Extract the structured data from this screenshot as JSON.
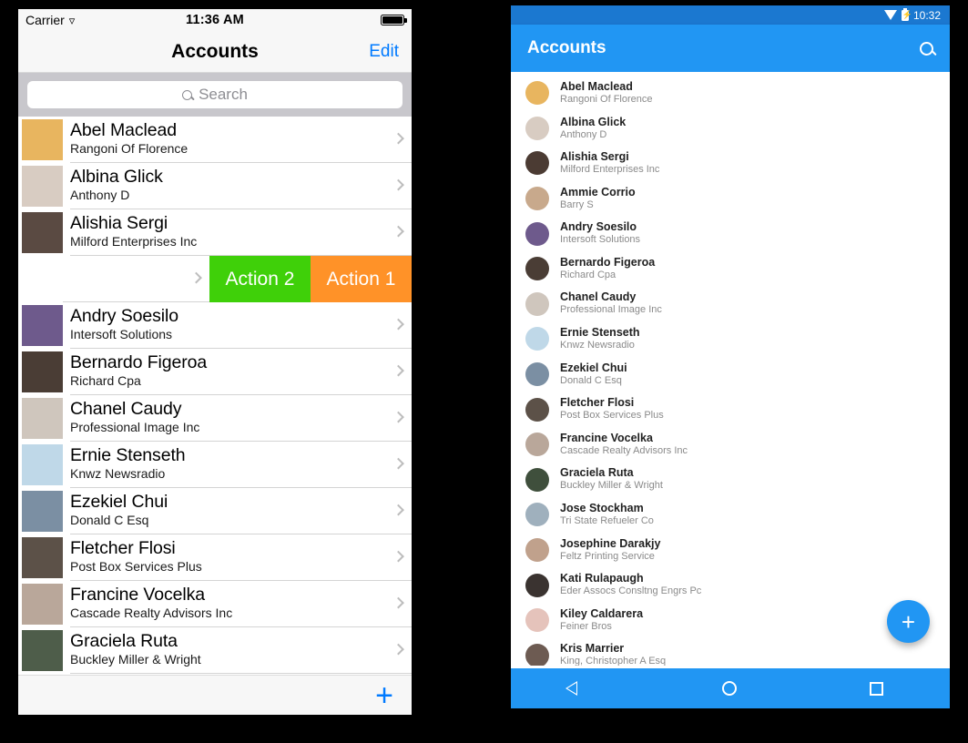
{
  "ios": {
    "status_bar": {
      "carrier": "Carrier",
      "wifi_icon": "wifi-icon",
      "time": "11:36 AM",
      "battery_icon": "battery-full-icon"
    },
    "nav": {
      "title": "Accounts",
      "edit_label": "Edit"
    },
    "search": {
      "icon": "search-icon",
      "placeholder": "Search",
      "value": ""
    },
    "toolbar": {
      "add_label": "+"
    },
    "swipe_actions": [
      {
        "label": "Action 2",
        "color": "#3fd009"
      },
      {
        "label": "Action 1",
        "color": "#ff9228"
      }
    ],
    "swiped_row_index": 3,
    "rows": [
      {
        "name": "Abel Maclead",
        "subtitle": "Rangoni Of Florence",
        "avatar": "#e8b55f"
      },
      {
        "name": "Albina Glick",
        "subtitle": "Anthony D",
        "avatar": "#d8ccc2"
      },
      {
        "name": "Alishia Sergi",
        "subtitle": "Milford Enterprises Inc",
        "avatar": "#5a4a42"
      },
      {
        "name": "",
        "subtitle": "",
        "avatar": "#8c7f70"
      },
      {
        "name": "Andry Soesilo",
        "subtitle": "Intersoft Solutions",
        "avatar": "#6e5a8c"
      },
      {
        "name": "Bernardo Figeroa",
        "subtitle": "Richard Cpa",
        "avatar": "#4a3d35"
      },
      {
        "name": "Chanel Caudy",
        "subtitle": "Professional Image Inc",
        "avatar": "#cfc6bd"
      },
      {
        "name": "Ernie Stenseth",
        "subtitle": "Knwz Newsradio",
        "avatar": "#bfd8e8"
      },
      {
        "name": "Ezekiel Chui",
        "subtitle": "Donald C Esq",
        "avatar": "#7b8fa3"
      },
      {
        "name": "Fletcher Flosi",
        "subtitle": "Post Box Services Plus",
        "avatar": "#5c5148"
      },
      {
        "name": "Francine Vocelka",
        "subtitle": "Cascade Realty Advisors Inc",
        "avatar": "#b9a79a"
      },
      {
        "name": "Graciela Ruta",
        "subtitle": "Buckley Miller & Wright",
        "avatar": "#4e5d4a"
      }
    ]
  },
  "android": {
    "status_bar": {
      "wifi_icon": "wifi-icon",
      "battery_icon": "battery-charging-icon",
      "time": "10:32"
    },
    "app_bar": {
      "title": "Accounts",
      "search_icon": "search-icon"
    },
    "fab": {
      "label": "+",
      "color": "#2196f3"
    },
    "nav_bar": {
      "back_icon": "back-triangle-icon",
      "home_icon": "home-circle-icon",
      "recents_icon": "recents-square-icon"
    },
    "colors": {
      "primary": "#2196f3",
      "status_bar": "#1b78d0"
    },
    "rows": [
      {
        "name": "Abel Maclead",
        "subtitle": "Rangoni Of Florence",
        "avatar": "#e8b55f"
      },
      {
        "name": "Albina Glick",
        "subtitle": "Anthony D",
        "avatar": "#d8ccc2"
      },
      {
        "name": "Alishia Sergi",
        "subtitle": "Milford Enterprises Inc",
        "avatar": "#4b3b33"
      },
      {
        "name": "Ammie Corrio",
        "subtitle": "Barry S",
        "avatar": "#c8a98c"
      },
      {
        "name": "Andry Soesilo",
        "subtitle": "Intersoft Solutions",
        "avatar": "#6e5a8c"
      },
      {
        "name": "Bernardo Figeroa",
        "subtitle": "Richard Cpa",
        "avatar": "#4a3d35"
      },
      {
        "name": "Chanel Caudy",
        "subtitle": "Professional Image Inc",
        "avatar": "#cfc6bd"
      },
      {
        "name": "Ernie Stenseth",
        "subtitle": "Knwz Newsradio",
        "avatar": "#bfd8e8"
      },
      {
        "name": "Ezekiel Chui",
        "subtitle": "Donald C Esq",
        "avatar": "#7b8fa3"
      },
      {
        "name": "Fletcher Flosi",
        "subtitle": "Post Box Services Plus",
        "avatar": "#5c5148"
      },
      {
        "name": "Francine Vocelka",
        "subtitle": "Cascade Realty Advisors Inc",
        "avatar": "#b9a79a"
      },
      {
        "name": "Graciela Ruta",
        "subtitle": "Buckley Miller & Wright",
        "avatar": "#3f4f3c"
      },
      {
        "name": "Jose Stockham",
        "subtitle": "Tri State Refueler Co",
        "avatar": "#9fb0bd"
      },
      {
        "name": "Josephine Darakjy",
        "subtitle": "Feltz Printing Service",
        "avatar": "#c0a18c"
      },
      {
        "name": "Kati Rulapaugh",
        "subtitle": "Eder Assocs Consltng Engrs Pc",
        "avatar": "#3a3330"
      },
      {
        "name": "Kiley Caldarera",
        "subtitle": "Feiner Bros",
        "avatar": "#e5c3bb"
      },
      {
        "name": "Kris Marrier",
        "subtitle": "King, Christopher A Esq",
        "avatar": "#6d5b52"
      }
    ]
  }
}
